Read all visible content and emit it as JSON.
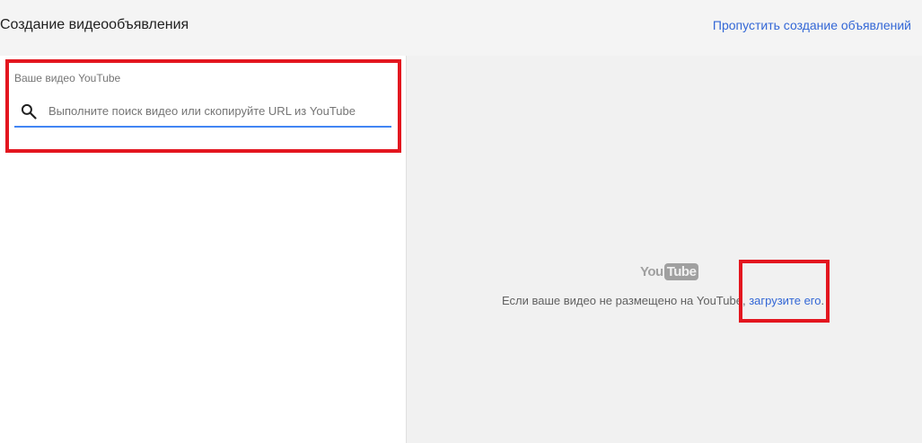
{
  "header": {
    "title": "Создание видеообъявления",
    "skip_link": "Пропустить создание объявлений"
  },
  "search": {
    "label": "Ваше видео YouTube",
    "placeholder": "Выполните поиск видео или скопируйте URL из YouTube",
    "value": ""
  },
  "preview": {
    "logo_you": "You",
    "logo_tube": "Tube",
    "message": "Если ваше видео не размещено на YouTube,",
    "upload_link": "загрузите его",
    "trailing": "."
  },
  "colors": {
    "accent": "#3367d6",
    "underline": "#4285f4",
    "highlight": "#e3161f"
  }
}
